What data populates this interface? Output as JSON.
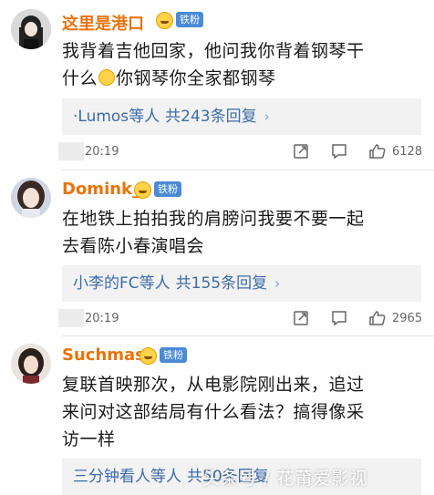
{
  "comments": [
    {
      "username": "这里是港口",
      "fan_badge": "铁粉",
      "text_line1": "我背着吉他回家，他问我你背着钢琴干",
      "text_line2a": "什么",
      "text_line2b": "你钢琴你全家都钢琴",
      "reply_users": "·Lumos等人",
      "reply_count": "共243条回复",
      "time": "20:19",
      "likes": "6128"
    },
    {
      "username": "Domink_",
      "fan_badge": "铁粉",
      "text_line1": "在地铁上拍拍我的肩膀问我要不要一起",
      "text_line2": "去看陈小春演唱会",
      "reply_users": "小李的FC等人",
      "reply_count": "共155条回复",
      "time": "20:19",
      "likes": "2965"
    },
    {
      "username": "Suchmas",
      "fan_badge": "铁粉",
      "text_line1": "复联首映那次，从电影院刚出来，追过",
      "text_line2": "来问对这部结局有什么看法？搞得像采",
      "text_line3": "访一样",
      "reply_users": "三分钟看人等人",
      "reply_count": "共50条回复"
    }
  ],
  "chevron": "›",
  "watermark": "头条号 / 花莆爱影视",
  "colors": {
    "username": "#e8730c",
    "link": "#3d6ca8",
    "reply_bg": "#f2f2f2",
    "badge_blue": "#4a8ad7"
  },
  "icons": [
    "share-icon",
    "comment-icon",
    "like-icon",
    "emoji-icon"
  ]
}
